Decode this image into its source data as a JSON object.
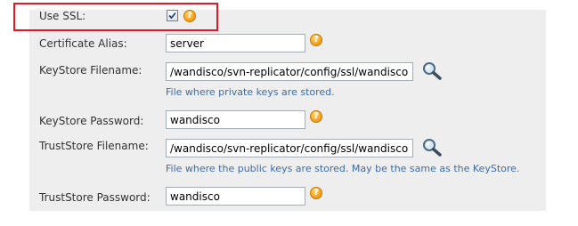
{
  "form": {
    "use_ssl": {
      "label": "Use SSL:",
      "checked": true
    },
    "certificate_alias": {
      "label": "Certificate Alias:",
      "value": "server"
    },
    "keystore_filename": {
      "label": "KeyStore Filename:",
      "value": "/wandisco/svn-replicator/config/ssl/wandisco.ks",
      "hint": "File where private keys are stored."
    },
    "keystore_password": {
      "label": "KeyStore Password:",
      "value": "wandisco"
    },
    "truststore_filename": {
      "label": "TrustStore Filename:",
      "value": "/wandisco/svn-replicator/config/ssl/wandisco.ks",
      "hint": "File where the public keys are stored. May be the same as the KeyStore."
    },
    "truststore_password": {
      "label": "TrustStore Password:",
      "value": "wandisco"
    }
  },
  "help_icon_glyph": "?",
  "icons": {
    "help": "help-icon",
    "browse": "magnifier-icon",
    "check": "checkmark-icon"
  },
  "colors": {
    "highlight_border": "#e11b1b",
    "hint_text": "#3d6ca3",
    "panel_bg": "#eeeeee",
    "help_icon": "#f6a623"
  }
}
